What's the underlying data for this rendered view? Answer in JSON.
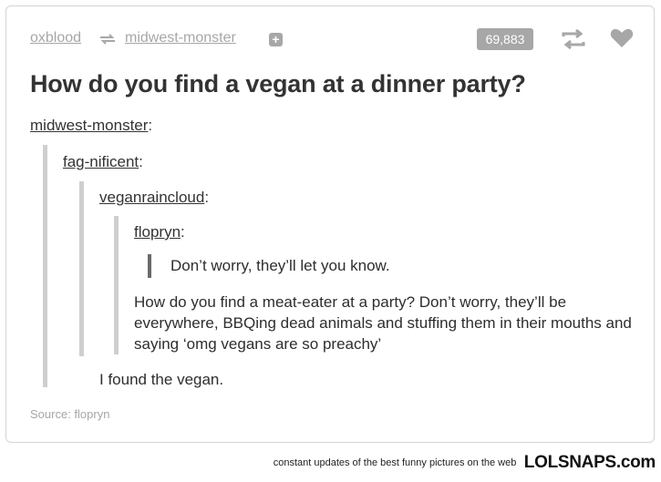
{
  "header": {
    "poster": "oxblood",
    "reblogged_from": "midwest-monster",
    "notes_count": "69,883",
    "icons": [
      "reblog-icon",
      "follow-plus-icon",
      "reblog-icon",
      "heart-icon"
    ]
  },
  "post": {
    "title": "How do you find a vegan at a dinner party?",
    "thread": [
      {
        "user": "midwest-monster"
      },
      {
        "user": "fag-nificent"
      },
      {
        "user": "veganraincloud"
      },
      {
        "user": "flopryn"
      }
    ],
    "quote": "Don’t worry, they’ll let you know.",
    "flopryn_reply": "How do you find a meat-eater at a party? Don’t worry, they’ll be everywhere, BBQing dead animals and stuffing them in their mouths and saying ‘omg vegans are so preachy’",
    "veganraincloud_reply": "I found the vegan.",
    "source": "Source: flopryn"
  },
  "footer": {
    "tagline": "constant updates of the best funny pictures on the web",
    "logo": "LOLSNAPS.com"
  },
  "colors": {
    "muted_gray": "#a7a7a7",
    "text": "#333333",
    "quote_bar": "#cfcfcf"
  }
}
